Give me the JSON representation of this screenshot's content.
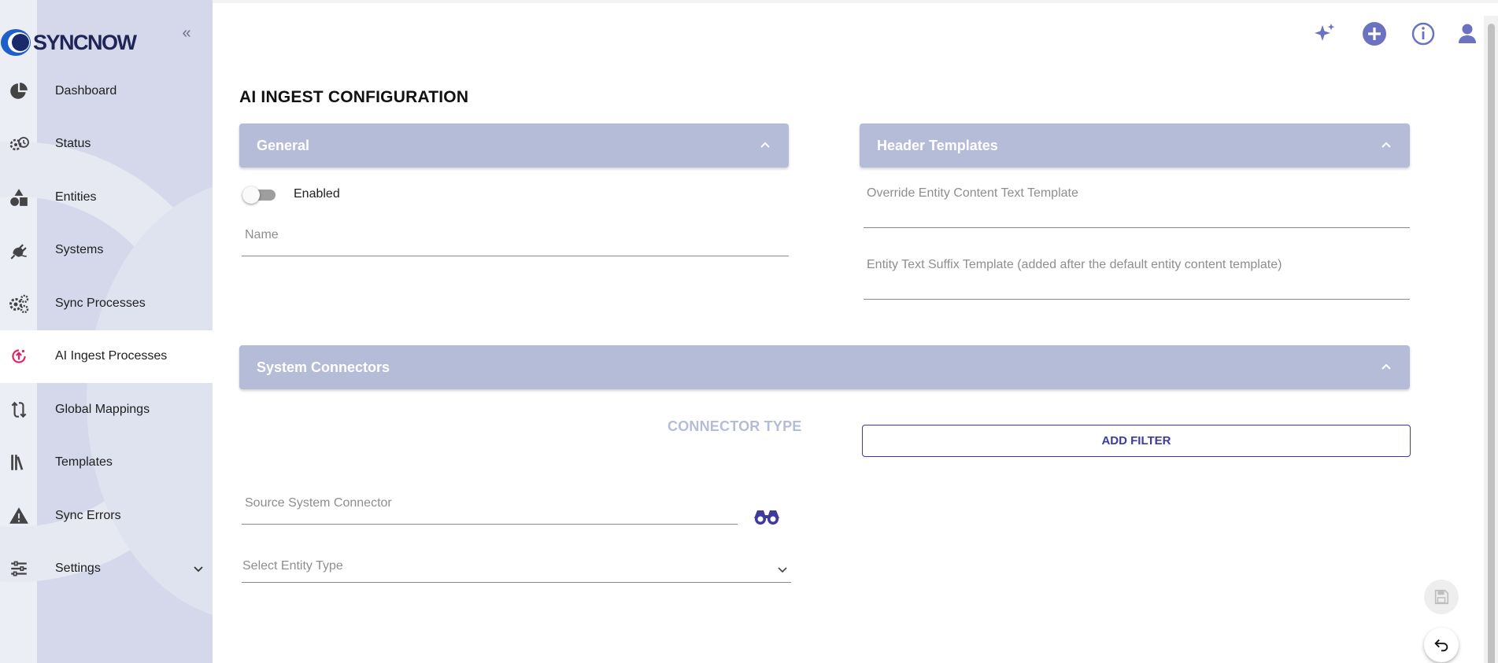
{
  "brand": {
    "name": "SYNCNOW"
  },
  "sidebar": {
    "collapse_icon": "double-chevron-left-icon",
    "items": [
      {
        "label": "Dashboard",
        "icon": "pie-chart-icon"
      },
      {
        "label": "Status",
        "icon": "gears-clock-icon"
      },
      {
        "label": "Entities",
        "icon": "shapes-icon"
      },
      {
        "label": "Systems",
        "icon": "plug-icon"
      },
      {
        "label": "Sync Processes",
        "icon": "gears-icon"
      },
      {
        "label": "AI Ingest Processes",
        "icon": "ai-ingest-icon",
        "active": true
      },
      {
        "label": "Global Mappings",
        "icon": "mapping-arrows-icon"
      },
      {
        "label": "Templates",
        "icon": "books-icon"
      },
      {
        "label": "Sync Errors",
        "icon": "warning-icon"
      },
      {
        "label": "Settings",
        "icon": "sliders-icon",
        "expandable": true
      }
    ]
  },
  "header": {
    "icons": [
      "sparkles-icon",
      "add-circle-icon",
      "info-icon",
      "user-icon"
    ]
  },
  "page": {
    "title": "AI INGEST CONFIGURATION"
  },
  "general": {
    "title": "General",
    "enabled_label": "Enabled",
    "enabled": false,
    "name_placeholder": "Name",
    "name_value": ""
  },
  "header_templates": {
    "title": "Header Templates",
    "override_placeholder": "Override Entity Content Text Template",
    "suffix_placeholder": "Entity Text Suffix Template (added after the default entity content template)"
  },
  "system_connectors": {
    "title": "System Connectors",
    "connector_type_label": "CONNECTOR TYPE",
    "add_filter_label": "ADD FILTER",
    "source_placeholder": "Source System Connector",
    "entity_type_placeholder": "Select Entity Type"
  },
  "fabs": {
    "save_icon": "save-icon",
    "undo_icon": "undo-icon"
  },
  "colors": {
    "accent": "#3f3a9e",
    "panel_header": "#b5bcd8",
    "sidebar_bg": "#d4d8ea",
    "active_icon": "#e91e63",
    "header_icon": "#6b73c1"
  }
}
